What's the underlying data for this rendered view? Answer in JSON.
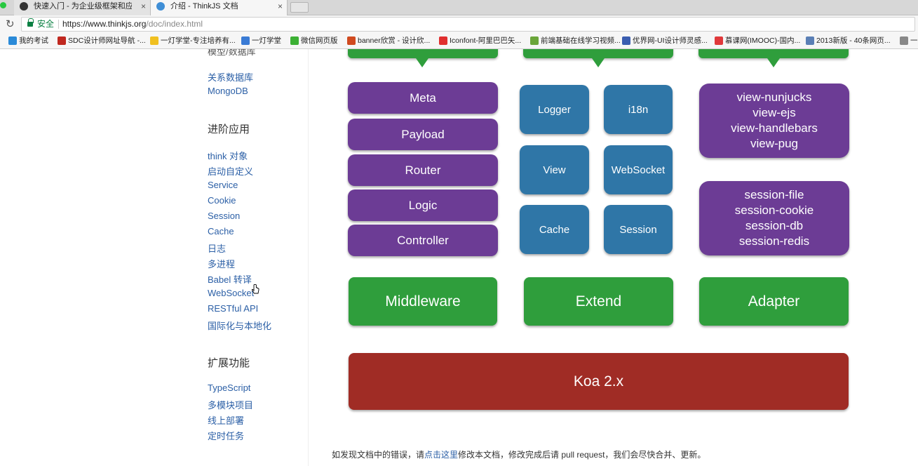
{
  "browser": {
    "tabs": [
      {
        "title": "快速入门 - 为企业级框架和应用",
        "active": false
      },
      {
        "title": "介绍 - ThinkJS 文档",
        "active": true
      }
    ],
    "address": {
      "secure_label": "安全",
      "url_host": "https://www.thinkjs.org",
      "url_path": "/doc/index.html"
    },
    "bookmarks": [
      {
        "label": "我的考试",
        "color": "#2a8ad8"
      },
      {
        "label": "SDC设计师网址导航 -...",
        "color": "#c0281f"
      },
      {
        "label": "一灯学堂-专注培养有...",
        "color": "#f0c020"
      },
      {
        "label": "一灯学堂",
        "color": "#3a7bd5"
      },
      {
        "label": "微信网页版",
        "color": "#3cb034"
      },
      {
        "label": "banner欣赏 - 设计欣...",
        "color": "#d04a1f"
      },
      {
        "label": "Iconfont-阿里巴巴矢...",
        "color": "#e02f2f"
      },
      {
        "label": "前端基础在线学习视频...",
        "color": "#6aa53a"
      },
      {
        "label": "优界网-UI设计师灵感...",
        "color": "#3a5db0"
      },
      {
        "label": "慕课网(IMOOC)-国内...",
        "color": "#e0393b"
      },
      {
        "label": "2013新版 - 40条网页...",
        "color": "#5a7fb5"
      },
      {
        "label": "一",
        "color": "#888888"
      }
    ]
  },
  "sidebar": {
    "cut_heading": "模型/数据库",
    "group1": [
      "关系数据库",
      "MongoDB"
    ],
    "heading2": "进阶应用",
    "group2": [
      "think 对象",
      "启动自定义",
      "Service",
      "Cookie",
      "Session",
      "Cache",
      "日志",
      "多进程",
      "Babel 转译",
      "WebSocket",
      "RESTful API",
      "国际化与本地化"
    ],
    "heading3": "扩展功能",
    "group3": [
      "TypeScript",
      "多模块项目",
      "线上部署",
      "定时任务"
    ]
  },
  "diagram": {
    "core": [
      "Meta",
      "Payload",
      "Router",
      "Logic",
      "Controller"
    ],
    "extend": [
      "Logger",
      "i18n",
      "View",
      "WebSocket",
      "Cache",
      "Session"
    ],
    "adapter_view": [
      "view-nunjucks",
      "view-ejs",
      "view-handlebars",
      "view-pug"
    ],
    "adapter_session": [
      "session-file",
      "session-cookie",
      "session-db",
      "session-redis"
    ],
    "middleware": "Middleware",
    "extend_label": "Extend",
    "adapter_label": "Adapter",
    "base": "Koa 2.x"
  },
  "footer": {
    "before": "如发现文档中的错误，请",
    "link": "点击这里",
    "after": "修改本文档，修改完成后请 pull request，我们会尽快合并、更新。"
  },
  "colors": {
    "purple": "#6c3c95",
    "blue": "#2f76a7",
    "green": "#2f9e3c",
    "red": "#a02c25",
    "link": "#2b5fa6"
  }
}
